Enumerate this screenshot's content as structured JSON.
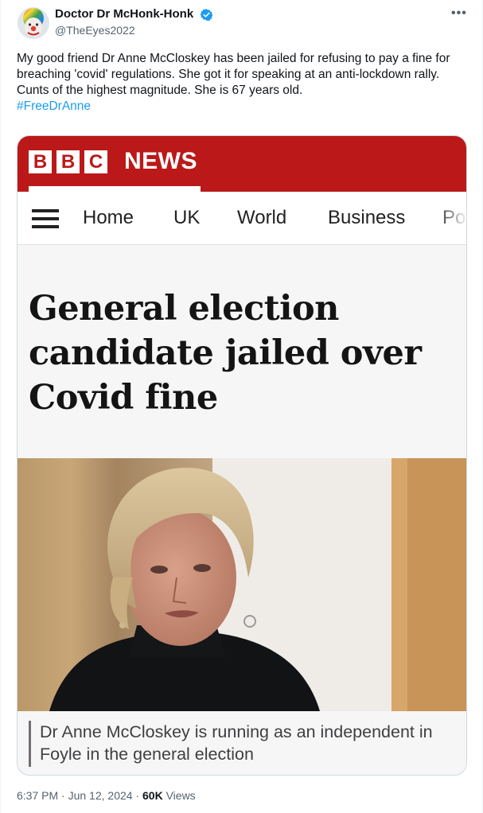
{
  "author": {
    "display_name": "Doctor Dr McHonk-Honk",
    "handle": "@TheEyes2022",
    "avatar_icon": "clown-avatar-icon",
    "verified_color": "#1d9bf0"
  },
  "menu_icon": "more-options-icon",
  "tweet": {
    "text": "My good friend Dr Anne McCloskey has been jailed for refusing to pay a fine for breaching 'covid' regulations. She got it for speaking at an anti-lockdown rally. Cunts of the highest magnitude. She is 67 years old.",
    "hashtag": "#FreeDrAnne"
  },
  "bbc": {
    "logo_letters": [
      "B",
      "B",
      "C"
    ],
    "news_label": "NEWS",
    "brand_color": "#bb1919",
    "nav": [
      "Home",
      "UK",
      "World",
      "Business",
      "Po"
    ],
    "headline": "General election candidate jailed over Covid fine",
    "caption": "Dr Anne McCloskey is running as an independent in Foyle in the general election"
  },
  "meta": {
    "time": "6:37 PM",
    "separator": "·",
    "date": "Jun 12, 2024",
    "views_count": "60K",
    "views_label": "Views"
  }
}
